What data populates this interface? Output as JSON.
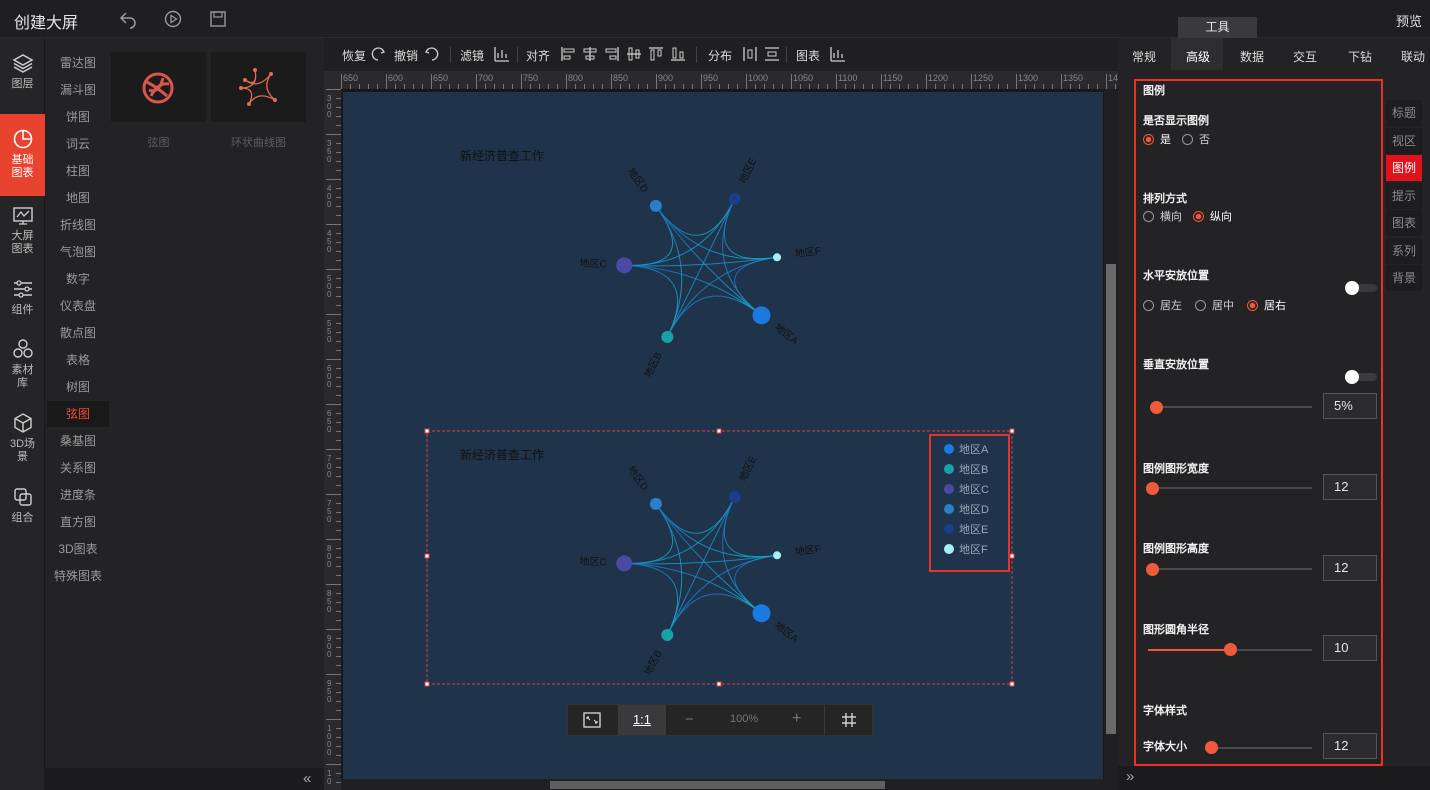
{
  "app_title": "创建大屏",
  "preview": "预览",
  "tool_tab": "工具",
  "left_nav": [
    {
      "label": "图层",
      "icon": "layers-icon"
    },
    {
      "label": "基础图表",
      "icon": "pie-chart-icon",
      "active": true
    },
    {
      "label": "大屏图表",
      "icon": "monitor-chart-icon"
    },
    {
      "label": "组件",
      "icon": "sliders-icon"
    },
    {
      "label": "素材库",
      "icon": "hexagons-icon"
    },
    {
      "label": "3D场景",
      "icon": "cube-icon"
    },
    {
      "label": "组合",
      "icon": "combine-icon"
    }
  ],
  "categories": [
    "雷达图",
    "漏斗图",
    "饼图",
    "词云",
    "柱图",
    "地图",
    "折线图",
    "气泡图",
    "数字",
    "仪表盘",
    "散点图",
    "表格",
    "树图",
    "弦图",
    "桑基图",
    "关系图",
    "进度条",
    "直方图",
    "3D图表",
    "特殊图表"
  ],
  "active_category": "弦图",
  "thumbnails": [
    {
      "label": "弦图"
    },
    {
      "label": "环状曲线图"
    }
  ],
  "toolbar": {
    "redo": "恢复",
    "undo": "撤销",
    "filter": "滤镜",
    "align": "对齐",
    "distribute": "分布",
    "chart": "图表"
  },
  "ruler_h": [
    "650",
    "600",
    "650",
    "700",
    "750",
    "800",
    "850",
    "900",
    "950",
    "1000",
    "1050",
    "1100",
    "1150",
    "1200",
    "1250",
    "1300",
    "1350",
    "14"
  ],
  "ruler_v": [
    "300",
    "350",
    "400",
    "450",
    "500",
    "550",
    "600",
    "650",
    "700",
    "750",
    "800",
    "850",
    "900",
    "950",
    "1000",
    "10"
  ],
  "chart1": {
    "title": "新经济普查工作"
  },
  "chart2": {
    "title": "新经济普查工作",
    "legend": [
      "地区A",
      "地区B",
      "地区C",
      "地区D",
      "地区E",
      "地区F"
    ]
  },
  "chart_data": {
    "type": "chord",
    "nodes": [
      "地区A",
      "地区B",
      "地区C",
      "地区D",
      "地区E",
      "地区F"
    ],
    "colors": [
      "#1a7ae0",
      "#17a2a8",
      "#4a4aa6",
      "#2b7fc8",
      "#1c3e8a",
      "#a8f0f8"
    ]
  },
  "zoom": {
    "ratio": "1:1",
    "minus": "−",
    "value": "100%",
    "plus": "+"
  },
  "right_tabs": [
    "常规",
    "高级",
    "数据",
    "交互",
    "下钻",
    "联动"
  ],
  "active_right_tab": "高级",
  "side_tabs": [
    "标题",
    "视区",
    "图例",
    "提示",
    "图表",
    "系列",
    "背景"
  ],
  "active_side_tab": "图例",
  "props": {
    "section": "图例",
    "show_legend_label": "是否显示图例",
    "show_yes": "是",
    "show_no": "否",
    "arrange_label": "排列方式",
    "arr_h": "横向",
    "arr_v": "纵向",
    "hpos_label": "水平安放位置",
    "h_left": "居左",
    "h_center": "居中",
    "h_right": "居右",
    "vpos_label": "垂直安放位置",
    "vpos_value": "5%",
    "width_label": "图例图形宽度",
    "width_value": "12",
    "height_label": "图例图形高度",
    "height_value": "12",
    "radius_label": "图形圆角半径",
    "radius_value": "10",
    "font_section": "字体样式",
    "font_size_label": "字体大小",
    "font_size_value": "12"
  }
}
